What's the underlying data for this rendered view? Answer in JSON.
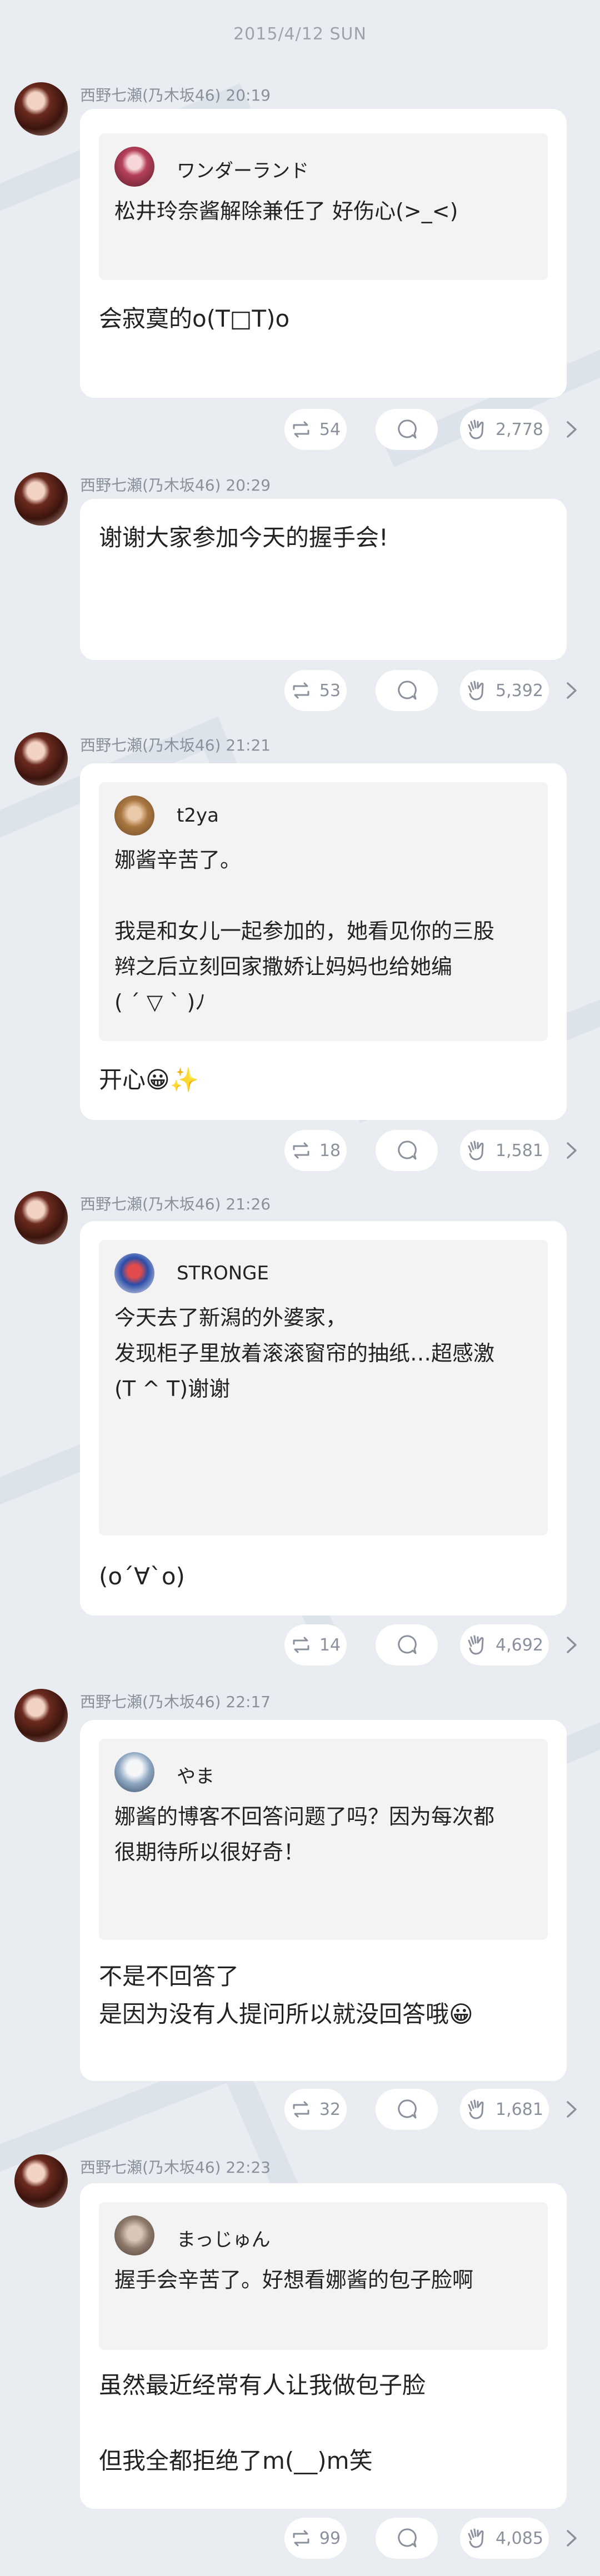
{
  "header": {
    "date": "2015/4/12 SUN"
  },
  "colors": {
    "background": "#e9edf2",
    "card": "#ffffff",
    "quote": "#f3f3f4",
    "muted": "#8a919c"
  },
  "posts": [
    {
      "author": "西野七瀬(乃木坂46)",
      "time": "20:19",
      "quote": {
        "name": "ワンダーランド",
        "text": "松井玲奈酱解除兼任了 好伤心(>_<)"
      },
      "reply": "会寂寞的o(T□T)o",
      "counts": {
        "repost": "54",
        "like": "2,778"
      }
    },
    {
      "author": "西野七瀬(乃木坂46)",
      "time": "20:29",
      "reply": "谢谢大家参加今天的握手会!",
      "counts": {
        "repost": "53",
        "like": "5,392"
      }
    },
    {
      "author": "西野七瀬(乃木坂46)",
      "time": "21:21",
      "quote": {
        "name": "t2ya",
        "text": "娜酱辛苦了。\n\n我是和女儿一起参加的，她看见你的三股\n辫之后立刻回家撒娇让妈妈也给她编\n( ´ ▽ ` )ﾉ"
      },
      "reply": "开心😀✨",
      "counts": {
        "repost": "18",
        "like": "1,581"
      }
    },
    {
      "author": "西野七瀬(乃木坂46)",
      "time": "21:26",
      "quote": {
        "name": "STRONGE",
        "text": "今天去了新潟的外婆家，\n发现柜子里放着滚滚窗帘的抽纸…超感激\n(T ^ T)谢谢"
      },
      "reply": "(o´∀`o)",
      "counts": {
        "repost": "14",
        "like": "4,692"
      }
    },
    {
      "author": "西野七瀬(乃木坂46)",
      "time": "22:17",
      "quote": {
        "name": "やま",
        "text": "娜酱的博客不回答问题了吗？因为每次都\n很期待所以很好奇！"
      },
      "reply": "不是不回答了\n是因为没有人提问所以就没回答哦😀",
      "counts": {
        "repost": "32",
        "like": "1,681"
      }
    },
    {
      "author": "西野七瀬(乃木坂46)",
      "time": "22:23",
      "quote": {
        "name": "まっじゅん",
        "text": "握手会辛苦了。好想看娜酱的包子脸啊"
      },
      "reply": "虽然最近经常有人让我做包子脸\n\n但我全都拒绝了m(__)m笑",
      "counts": {
        "repost": "99",
        "like": "4,085"
      }
    }
  ]
}
